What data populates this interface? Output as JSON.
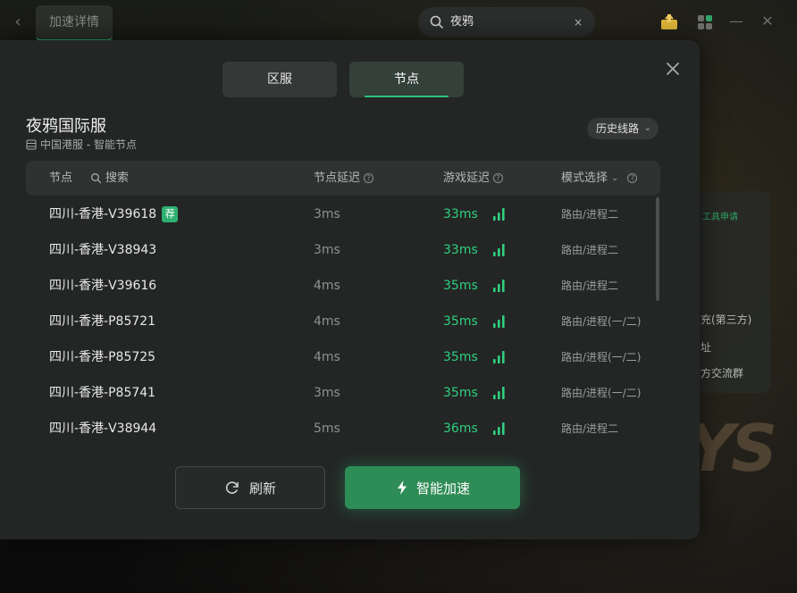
{
  "topbar": {
    "page_tab": "加速详情",
    "search_value": "夜鸦",
    "search_clear": "×"
  },
  "background": {
    "tool_label": "工具申请",
    "lines": [
      "充(第三方)",
      "址",
      "方交流群"
    ],
    "logo_text": "YS"
  },
  "modal": {
    "tabs": [
      "区服",
      "节点"
    ],
    "active_tab": "节点",
    "game_title": "夜鸦国际服",
    "subtitle": "中国港服 - 智能节点",
    "history_button": "历史线路",
    "columns": {
      "node": "节点",
      "search": "搜索",
      "node_latency": "节点延迟",
      "game_latency": "游戏延迟",
      "mode": "模式选择"
    },
    "recommend_badge": "荐",
    "rows": [
      {
        "name": "四川-香港-V39618",
        "recommended": true,
        "node_latency": "3ms",
        "game_latency": "33ms",
        "mode": "路由/进程二"
      },
      {
        "name": "四川-香港-V38943",
        "recommended": false,
        "node_latency": "3ms",
        "game_latency": "33ms",
        "mode": "路由/进程二"
      },
      {
        "name": "四川-香港-V39616",
        "recommended": false,
        "node_latency": "4ms",
        "game_latency": "35ms",
        "mode": "路由/进程二"
      },
      {
        "name": "四川-香港-P85721",
        "recommended": false,
        "node_latency": "4ms",
        "game_latency": "35ms",
        "mode": "路由/进程(一/二)"
      },
      {
        "name": "四川-香港-P85725",
        "recommended": false,
        "node_latency": "4ms",
        "game_latency": "35ms",
        "mode": "路由/进程(一/二)"
      },
      {
        "name": "四川-香港-P85741",
        "recommended": false,
        "node_latency": "3ms",
        "game_latency": "35ms",
        "mode": "路由/进程(一/二)"
      },
      {
        "name": "四川-香港-V38944",
        "recommended": false,
        "node_latency": "5ms",
        "game_latency": "36ms",
        "mode": "路由/进程二"
      }
    ],
    "refresh_button": "刷新",
    "accelerate_button": "智能加速"
  },
  "colors": {
    "accent": "#2fc27a",
    "latency_good": "#2fd07f",
    "button_primary": "#2e8c56"
  },
  "icons": [
    "back-icon",
    "search-icon",
    "gift-icon",
    "apps-icon",
    "minimize-icon",
    "close-icon",
    "server-icon",
    "chevron-down-icon",
    "help-icon",
    "signal-icon",
    "refresh-icon",
    "lightning-icon"
  ]
}
